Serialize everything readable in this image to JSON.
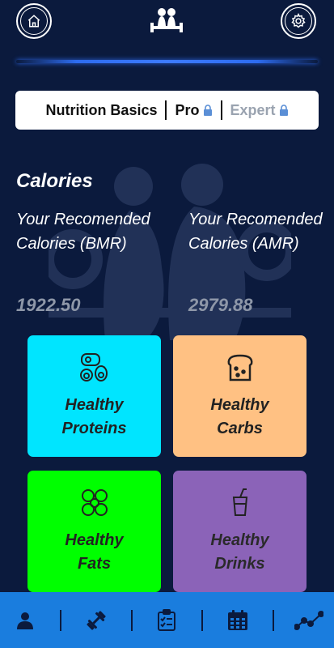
{
  "header": {
    "home_icon": "home-icon",
    "logo_icon": "gym-couple-logo-icon",
    "settings_icon": "gear-icon"
  },
  "tabs": [
    {
      "label": "Nutrition Basics",
      "locked": false
    },
    {
      "label": "Pro",
      "locked": true
    },
    {
      "label": "Expert",
      "locked": true
    }
  ],
  "calories": {
    "title": "Calories",
    "bmr_label": "Your Recomended Calories (BMR)",
    "bmr_value": "1922.50",
    "amr_label": "Your Recomended Calories (AMR)",
    "amr_value": "2979.88"
  },
  "cards": [
    {
      "line1": "Healthy",
      "line2": "Proteins",
      "icon": "meat-egg-icon",
      "color": "#00e5ff"
    },
    {
      "line1": "Healthy",
      "line2": "Carbs",
      "icon": "bread-icon",
      "color": "#ffc183"
    },
    {
      "line1": "Healthy",
      "line2": "Fats",
      "icon": "nuts-icon",
      "color": "#00ff00"
    },
    {
      "line1": "Healthy",
      "line2": "Drinks",
      "icon": "drink-cup-icon",
      "color": "#8b63b8"
    }
  ],
  "bottom_nav": [
    {
      "icon": "user-icon"
    },
    {
      "icon": "dumbbell-icon"
    },
    {
      "icon": "clipboard-checklist-icon"
    },
    {
      "icon": "calendar-icon"
    },
    {
      "icon": "progress-chart-icon"
    }
  ],
  "colors": {
    "background": "#0b1a3d",
    "accent_line": "#2d6cf0",
    "nav_bar": "#1a7dde",
    "value_text": "#8e97a8"
  }
}
